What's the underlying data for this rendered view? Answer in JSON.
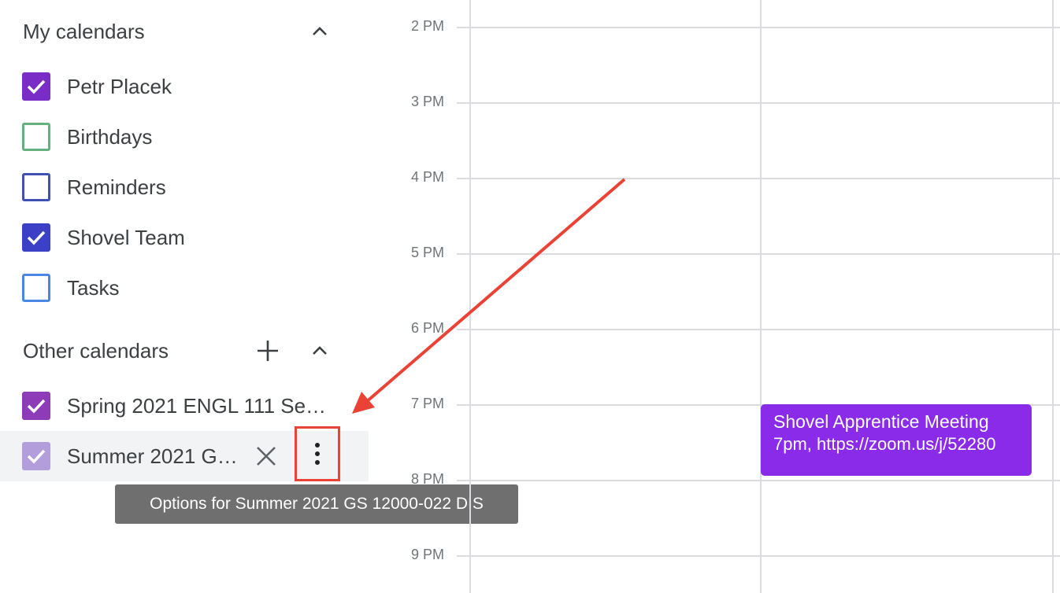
{
  "my_calendars": {
    "title": "My calendars",
    "items": [
      {
        "label": "Petr Placek",
        "checked": true,
        "color": "#7a2cc7"
      },
      {
        "label": "Birthdays",
        "checked": false,
        "color": "#66b07e"
      },
      {
        "label": "Reminders",
        "checked": false,
        "color": "#3f51b5"
      },
      {
        "label": "Shovel Team",
        "checked": true,
        "color": "#3c40c6"
      },
      {
        "label": "Tasks",
        "checked": false,
        "color": "#4a86e8"
      }
    ]
  },
  "other_calendars": {
    "title": "Other calendars",
    "items": [
      {
        "label": "Spring 2021 ENGL 111 Se…",
        "checked": true,
        "color": "#8e3bb8"
      },
      {
        "label": "Summer 2021 G…",
        "checked": true,
        "color": "#b39ddb"
      }
    ]
  },
  "tooltip": "Options for Summer 2021 GS 12000-022 DIS",
  "hours": [
    "2 PM",
    "3 PM",
    "4 PM",
    "5 PM",
    "6 PM",
    "7 PM",
    "8 PM",
    "9 PM"
  ],
  "event": {
    "title": "Shovel Apprentice Meeting",
    "detail": "7pm, https://zoom.us/j/52280",
    "color": "#8b2bea"
  },
  "colors": {
    "annotation_red": "#ea4335"
  }
}
